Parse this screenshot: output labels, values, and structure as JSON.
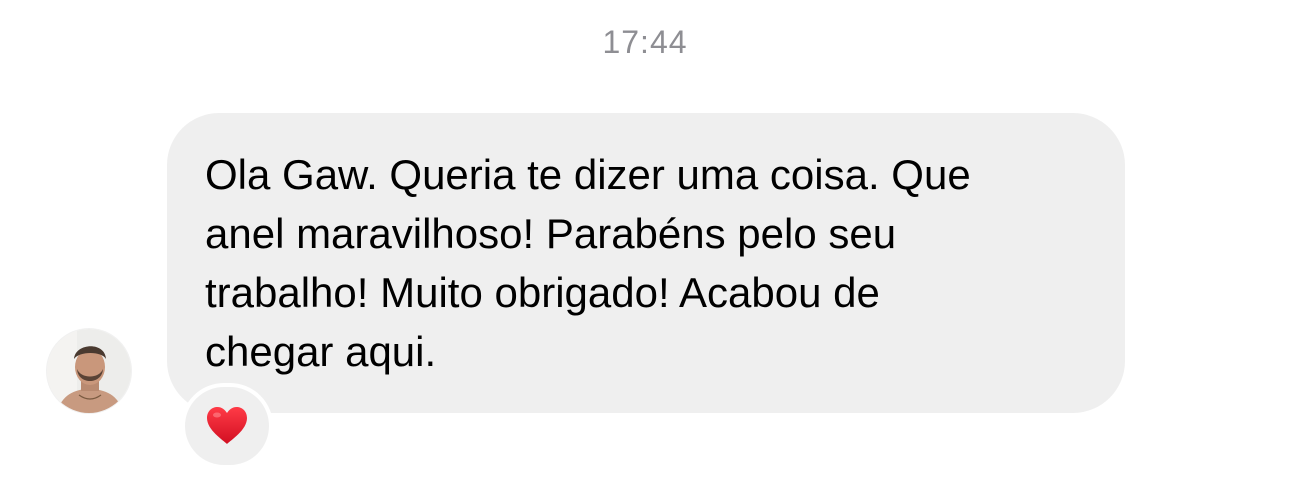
{
  "chat": {
    "timestamp": "17:44",
    "message": {
      "text": "Ola Gaw. Queria te dizer uma coisa. Que\nanel maravilhoso! Parabéns pelo seu\ntrabalho!  Muito obrigado! Acabou de\nchegar aqui.",
      "bubble_color": "#efefef",
      "reaction": {
        "emoji_name": "red-heart",
        "color": "#e0102a"
      }
    },
    "sender": {
      "avatar_icon": "profile-photo"
    }
  }
}
